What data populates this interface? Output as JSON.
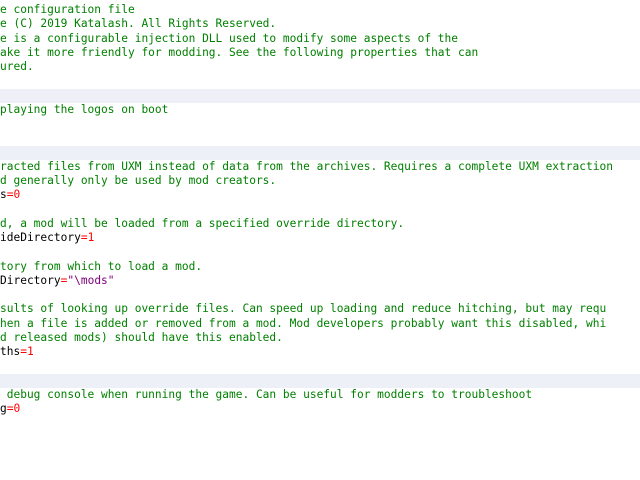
{
  "lines": [
    {
      "type": "comment",
      "band": false,
      "text": "e configuration file"
    },
    {
      "type": "comment",
      "band": false,
      "text": "e (C) 2019 Katalash. All Rights Reserved."
    },
    {
      "type": "comment",
      "band": false,
      "text": "e is a configurable injection DLL used to modify some aspects of the"
    },
    {
      "type": "comment",
      "band": false,
      "text": "ake it more friendly for modding. See the following properties that can"
    },
    {
      "type": "comment",
      "band": false,
      "text": "ured."
    },
    {
      "type": "blank",
      "band": false,
      "text": ""
    },
    {
      "type": "blank",
      "band": true,
      "text": ""
    },
    {
      "type": "comment",
      "band": false,
      "text": "playing the logos on boot"
    },
    {
      "type": "blank",
      "band": false,
      "text": ""
    },
    {
      "type": "blank",
      "band": false,
      "text": ""
    },
    {
      "type": "blank",
      "band": true,
      "text": ""
    },
    {
      "type": "comment",
      "band": false,
      "text": "racted files from UXM instead of data from the archives. Requires a complete UXM extraction"
    },
    {
      "type": "comment",
      "band": false,
      "text": "d generally only be used by mod creators."
    },
    {
      "type": "kv",
      "band": false,
      "key": "s",
      "op": "=",
      "value": "0",
      "vtype": "num"
    },
    {
      "type": "blank",
      "band": false,
      "text": ""
    },
    {
      "type": "comment",
      "band": false,
      "text": "d, a mod will be loaded from a specified override directory."
    },
    {
      "type": "kv",
      "band": false,
      "key": "ideDirectory",
      "op": "=",
      "value": "1",
      "vtype": "num"
    },
    {
      "type": "blank",
      "band": false,
      "text": ""
    },
    {
      "type": "comment",
      "band": false,
      "text": "tory from which to load a mod."
    },
    {
      "type": "kv",
      "band": false,
      "key": "Directory",
      "op": "=",
      "value": "\"\\mods\"",
      "vtype": "str"
    },
    {
      "type": "blank",
      "band": false,
      "text": ""
    },
    {
      "type": "comment",
      "band": false,
      "text": "sults of looking up override files. Can speed up loading and reduce hitching, but may requ"
    },
    {
      "type": "comment",
      "band": false,
      "text": "hen a file is added or removed from a mod. Mod developers probably want this disabled, whi"
    },
    {
      "type": "comment",
      "band": false,
      "text": "d released mods) should have this enabled."
    },
    {
      "type": "kv",
      "band": false,
      "key": "ths",
      "op": "=",
      "value": "1",
      "vtype": "num"
    },
    {
      "type": "blank",
      "band": false,
      "text": ""
    },
    {
      "type": "blank",
      "band": true,
      "text": ""
    },
    {
      "type": "comment",
      "band": false,
      "text": " debug console when running the game. Can be useful for modders to troubleshoot"
    },
    {
      "type": "kv",
      "band": false,
      "key": "g",
      "op": "=",
      "value": "0",
      "vtype": "num"
    }
  ]
}
